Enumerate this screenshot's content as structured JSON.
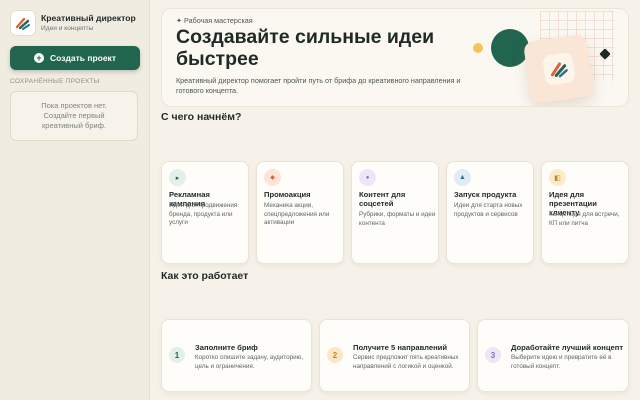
{
  "brand": {
    "title": "Креативный директор",
    "subtitle": "Идеи и концепты",
    "logo_icon": "brush-strokes-logo"
  },
  "sidebar": {
    "create_button": "Создать проект",
    "saved_heading": "СОХРАНЁННЫЕ ПРОЕКТЫ",
    "empty_state": "Пока проектов нет. Создайте первый креативный бриф."
  },
  "hero": {
    "eyebrow": "✦ Рабочая мастерская",
    "title": "Создавайте сильные идеи быстрее",
    "description": "Креативный директор помогает пройти путь от брифа до креативного направления и готового концепта."
  },
  "start_section": {
    "title": "С чего начнём?",
    "cards": [
      {
        "title": "Рекламная кампания",
        "description": "Идея для продвижения бренда, продукта или услуги",
        "icon": "play-icon",
        "icon_glyph": "▸",
        "icon_bg": "#e3efe9",
        "icon_color": "#21654f"
      },
      {
        "title": "Промоакция",
        "description": "Механика акции, спецпредложения или активации",
        "icon": "spark-icon",
        "icon_glyph": "◆",
        "icon_bg": "#fde4da",
        "icon_color": "#e0603a"
      },
      {
        "title": "Контент для соцсетей",
        "description": "Рубрики, форматы и идеи контента",
        "icon": "dot-icon",
        "icon_glyph": "●",
        "icon_bg": "#ece6f7",
        "icon_color": "#8a67c9"
      },
      {
        "title": "Запуск продукта",
        "description": "Идеи для старта новых продуктов и сервисов",
        "icon": "triangle-icon",
        "icon_glyph": "▲",
        "icon_bg": "#e0ecf5",
        "icon_color": "#2d6f98"
      },
      {
        "title": "Идея для презентации клиенту",
        "description": "Концепция для встречи, КП или питча",
        "icon": "slides-icon",
        "icon_glyph": "◧",
        "icon_bg": "#fbecc9",
        "icon_color": "#c28a1c"
      }
    ]
  },
  "how_section": {
    "title": "Как это работает",
    "steps": [
      {
        "number": "1",
        "title": "Заполните бриф",
        "description": "Коротко опишите задачу, аудиторию, цель и ограничения.",
        "bg": "#e3efe9",
        "color": "#21654f"
      },
      {
        "number": "2",
        "title": "Получите 5 направлений",
        "description": "Сервис предложит пять креативных направлений с логикой и оценкой.",
        "bg": "#fbe7c4",
        "color": "#c28a1c"
      },
      {
        "number": "3",
        "title": "Доработайте лучший концепт",
        "description": "Выберите идею и превратите её в готовый концепт.",
        "bg": "#ece6f7",
        "color": "#8a67c9"
      }
    ]
  },
  "colors": {
    "accent": "#21654f",
    "background": "#f6f2e9",
    "sidebar": "#f1ece1"
  }
}
